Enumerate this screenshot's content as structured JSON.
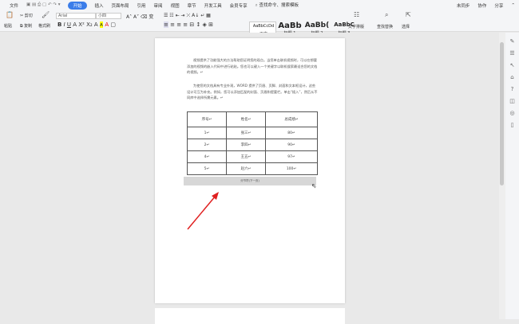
{
  "menu": {
    "file": "文件",
    "tabs": [
      "开始",
      "插入",
      "页面布局",
      "引用",
      "审阅",
      "视图",
      "章节",
      "开发工具",
      "会员专享"
    ],
    "search": "查找命令、搜索模板",
    "right": [
      "未同步",
      "协作",
      "分享"
    ]
  },
  "toolbar": {
    "paste": "粘贴",
    "cut": "剪切",
    "copy": "复制",
    "format_painter": "格式刷",
    "font": "Arial",
    "size": "小四",
    "styles": [
      {
        "sample": "AaBbCcDd",
        "label": "正文"
      },
      {
        "sample": "AaBb",
        "label": "标题 1"
      },
      {
        "sample": "AaBb(",
        "label": "标题 2"
      },
      {
        "sample": "AaBbC",
        "label": "标题 3"
      }
    ],
    "text_layout": "文字排版",
    "find_replace": "查找替换",
    "select": "选择"
  },
  "doc": {
    "para1": "视频提供了功能强大的方法帮助您证明您的观点。当您单击联机视频时，可以在想要添加的视频的嵌入代码中进行粘贴。您也可以键入一个关键字以联机搜索最适合您的文档的视频。↵",
    "para2": "为使您的文档具有专业外观，WORD 提供了页眉、页脚、封面和文本框设计，这些设计可互为补充。例如，您可以添加匹配的封面、页眉和提要栏。单击“插入”，然后从不同库中选择所需元素。↵",
    "table": {
      "headers": [
        "序号↵",
        "姓名↵",
        "总成绩↵"
      ],
      "rows": [
        [
          "1↵",
          "张三↵",
          "80↵"
        ],
        [
          "2↵",
          "李四↵",
          "90↵"
        ],
        [
          "4↵",
          "王五↵",
          "97↵"
        ],
        [
          "5↵",
          "赵六↵",
          "100↵"
        ]
      ]
    },
    "section_break": "分节符(下一页)"
  },
  "colors": {
    "accent": "#3b7de9",
    "arrow": "#e02020"
  }
}
